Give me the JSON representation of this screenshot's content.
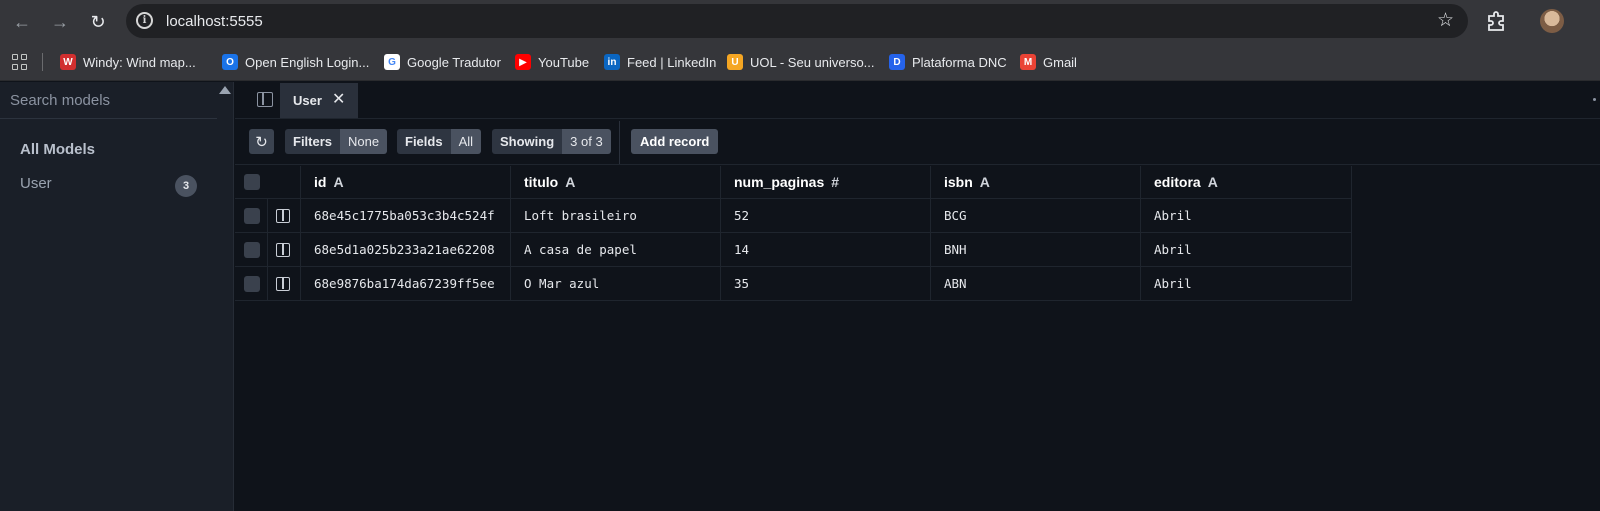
{
  "browser": {
    "url": "localhost:5555",
    "bookmarks": [
      {
        "label": "Windy: Wind map...",
        "color": "#d12f2f",
        "glyph": "W"
      },
      {
        "label": "Open English Login...",
        "color": "#1a73e8",
        "glyph": "O"
      },
      {
        "label": "Google Tradutor",
        "color": "#ffffff",
        "glyph": "G"
      },
      {
        "label": "YouTube",
        "color": "#ff0000",
        "glyph": "▶"
      },
      {
        "label": "Feed | LinkedIn",
        "color": "#0a66c2",
        "glyph": "in"
      },
      {
        "label": "UOL - Seu universo...",
        "color": "#f5a623",
        "glyph": "U"
      },
      {
        "label": "Plataforma DNC",
        "color": "#2563eb",
        "glyph": "D"
      },
      {
        "label": "Gmail",
        "color": "#ea4335",
        "glyph": "M"
      }
    ]
  },
  "sidebar": {
    "search_placeholder": "Search models",
    "section_title": "All Models",
    "models": [
      {
        "name": "User",
        "count": "3"
      }
    ]
  },
  "tabs": [
    {
      "label": "User"
    }
  ],
  "toolbar": {
    "filters_label": "Filters",
    "filters_value": "None",
    "fields_label": "Fields",
    "fields_value": "All",
    "showing_label": "Showing",
    "showing_value": "3 of 3",
    "add_record_label": "Add record"
  },
  "table": {
    "columns": [
      {
        "name": "id",
        "type": "A"
      },
      {
        "name": "titulo",
        "type": "A"
      },
      {
        "name": "num_paginas",
        "type": "#"
      },
      {
        "name": "isbn",
        "type": "A"
      },
      {
        "name": "editora",
        "type": "A"
      }
    ],
    "rows": [
      [
        "68e45c1775ba053c3b4c524f",
        "Loft brasileiro",
        "52",
        "BCG",
        "Abril"
      ],
      [
        "68e5d1a025b233a21ae62208",
        "A casa de papel",
        "14",
        "BNH",
        "Abril"
      ],
      [
        "68e9876ba174da67239ff5ee",
        "O Mar azul",
        "35",
        "ABN",
        "Abril"
      ]
    ]
  }
}
